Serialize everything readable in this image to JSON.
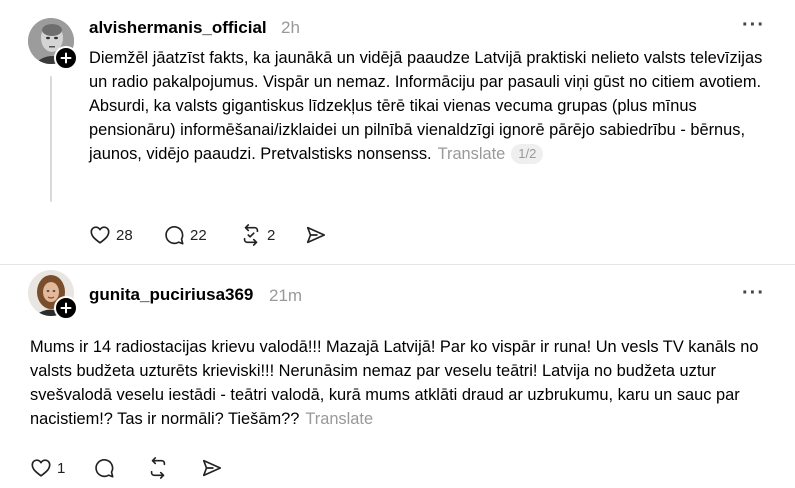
{
  "posts": [
    {
      "username": "alvishermanis_official",
      "time": "2h",
      "text": "Diemžēl jāatzīst fakts, ka jaunākā un vidējā paaudze Latvijā praktiski nelieto valsts televīzijas un radio pakalpojumus. Vispār un nemaz. Informāciju par pasauli viņi gūst no citiem avotiem. Absurdi, ka valsts gigantiskus līdzekļus tērē tikai vienas vecuma grupas (plus mīnus pensionāru) informēšanai/izklaidei un pilnībā vienaldzīgi ignorē pārējo sabiedrību - bērnus, jaunos, vidējo paaudzi. Pretvalstisks nonsenss.",
      "translate": "Translate",
      "pager": "1/2",
      "likes": "28",
      "replies": "22",
      "reposts": "2"
    },
    {
      "username": "gunita_puciriusa369",
      "time": "21m",
      "text": "Mums ir 14 radiostacijas krievu valodā!!! Mazajā Latvijā! Par ko vispār ir runa! Un vesls TV kanāls no valsts budžeta uzturēts krieviski!!! Nerunāsim nemaz par veselu teātri! Latvija no budžeta uztur svešvalodā veselu iestādi - teātri valodā, kurā mums atklāti draud ar uzbrukumu, karu un sauc par nacistiem!? Tas ir normāli? Tiešām??",
      "translate": "Translate",
      "likes": "1"
    }
  ],
  "icons": {
    "more": "more-options-icon",
    "like": "heart-icon",
    "reply": "comment-icon",
    "repost": "repost-icon",
    "share": "send-icon",
    "follow": "plus-icon"
  }
}
